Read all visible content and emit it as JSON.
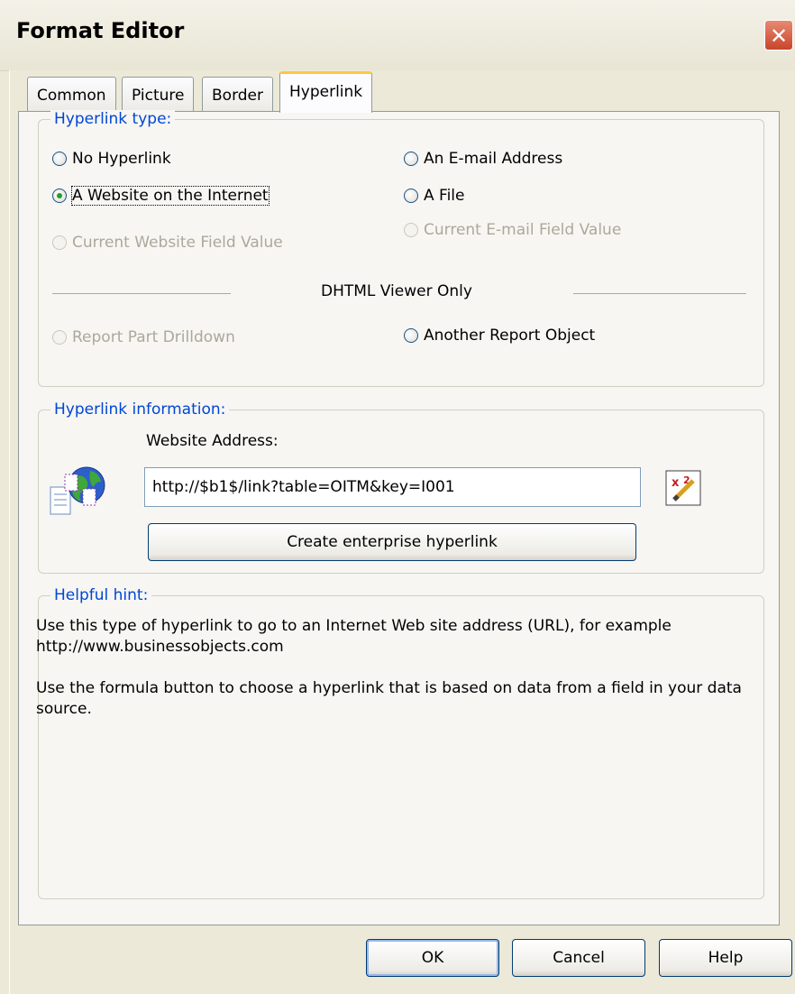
{
  "window": {
    "title": "Format Editor",
    "close_glyph": "✕"
  },
  "tabs": [
    {
      "label": "Common",
      "active": false
    },
    {
      "label": "Picture",
      "active": false
    },
    {
      "label": "Border",
      "active": false
    },
    {
      "label": "Hyperlink",
      "active": true
    }
  ],
  "hyperlink_type": {
    "legend": "Hyperlink type:",
    "options": [
      {
        "label": "No Hyperlink",
        "checked": false,
        "enabled": true
      },
      {
        "label": "An E-mail Address",
        "checked": false,
        "enabled": true
      },
      {
        "label": "A Website on the Internet",
        "checked": true,
        "enabled": true
      },
      {
        "label": "A File",
        "checked": false,
        "enabled": true
      },
      {
        "label": "Current Website Field Value",
        "checked": false,
        "enabled": false
      },
      {
        "label": "Current E-mail Field Value",
        "checked": false,
        "enabled": false
      },
      {
        "label": "Report Part Drilldown",
        "checked": false,
        "enabled": false
      },
      {
        "label": "Another Report Object",
        "checked": false,
        "enabled": true
      }
    ],
    "separator_label": "DHTML Viewer Only"
  },
  "hyperlink_info": {
    "legend": "Hyperlink information:",
    "address_label": "Website Address:",
    "address_value": "http://$b1$/link?table=OITM&key=I001",
    "formula_icon": "formula-icon",
    "globe_icon": "globe-icon",
    "create_button": "Create enterprise hyperlink"
  },
  "hint": {
    "legend": "Helpful hint:",
    "line1": "Use this type of hyperlink to go to an Internet Web site address (URL), for example http://www.businessobjects.com",
    "line2": "Use the formula button to choose a hyperlink that is based on data from a field in your data source."
  },
  "footer": {
    "ok": "OK",
    "cancel": "Cancel",
    "help": "Help"
  },
  "colors": {
    "legend": "#0046d5",
    "tab_highlight": "#ffc83c",
    "checked_dot": "#21a121",
    "disabled_text": "#aca899"
  }
}
